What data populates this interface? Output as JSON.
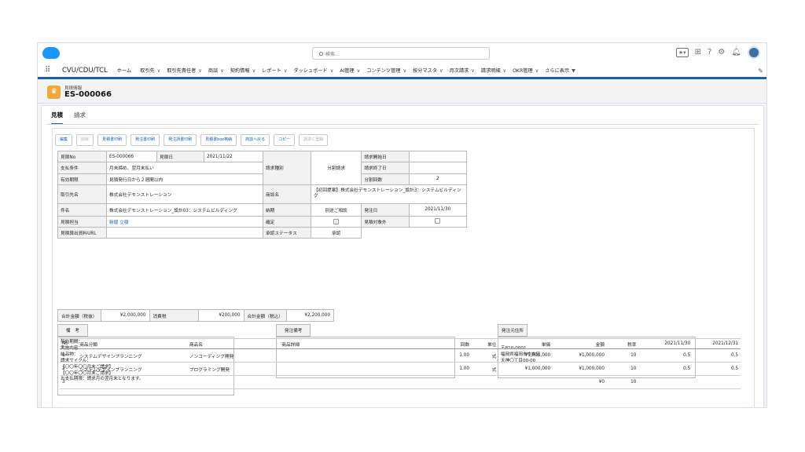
{
  "header": {
    "search_placeholder": "検索...",
    "icons": [
      "star-icon",
      "add-icon",
      "help-icon",
      "gear-icon",
      "bell-icon",
      "avatar"
    ]
  },
  "nav": {
    "app_name": "CVU/CDU/TCL",
    "items": [
      {
        "label": "ホーム",
        "chev": ""
      },
      {
        "label": "取引先",
        "chev": "∨"
      },
      {
        "label": "取引先責任者",
        "chev": "∨"
      },
      {
        "label": "商談",
        "chev": "∨"
      },
      {
        "label": "契約情報",
        "chev": "∨"
      },
      {
        "label": "レポート",
        "chev": "∨"
      },
      {
        "label": "ダッシュボード",
        "chev": "∨"
      },
      {
        "label": "AI管理",
        "chev": "∨"
      },
      {
        "label": "コンテンツ管理",
        "chev": "∨"
      },
      {
        "label": "按分マスタ",
        "chev": "∨"
      },
      {
        "label": "月次請求",
        "chev": "∨"
      },
      {
        "label": "請求明細",
        "chev": "∨"
      },
      {
        "label": "OKR管理",
        "chev": "∨"
      },
      {
        "label": "さらに表示",
        "chev": "▼"
      }
    ]
  },
  "record": {
    "object_label": "見積情報",
    "title": "ES-000066"
  },
  "tabs": [
    "見積",
    "請求"
  ],
  "buttons": [
    {
      "label": "編集",
      "disabled": false
    },
    {
      "label": "削除",
      "disabled": true
    },
    {
      "label": "見積書印刷",
      "disabled": false
    },
    {
      "label": "発注書印刷",
      "disabled": false
    },
    {
      "label": "発注請書印刷",
      "disabled": false
    },
    {
      "label": "見積書box格納",
      "disabled": false
    },
    {
      "label": "商談へ戻る",
      "disabled": false
    },
    {
      "label": "コピー",
      "disabled": false
    },
    {
      "label": "請求に登録",
      "disabled": true
    }
  ],
  "fields": {
    "estimate_no_label": "見積No",
    "estimate_no": "ES-000066",
    "estimate_date_label": "見積日",
    "estimate_date": "2021/11/22",
    "payment_terms_label": "支払条件",
    "payment_terms": "月末締め、翌月末払い",
    "validity_label": "有効期限",
    "validity": "見積発行日から２週間以内",
    "billing_type_label": "請求種別",
    "billing_type": "分割請求",
    "billing_start_label": "請求開始日",
    "billing_start": "",
    "billing_end_label": "請求終了日",
    "billing_end": "",
    "installments_label": "分割回数",
    "installments": "2",
    "account_label": "取引先名",
    "account": "株式会社デモンストレーション",
    "opportunity_label": "商談名",
    "opportunity": "【初回提案】株式会社デモンストレーション_設計3：システムビルディング",
    "subject_label": "件名",
    "subject": "株式会社デモンストレーション_設計03：システムビルディング",
    "delivery_label": "納期",
    "delivery": "別途ご相談",
    "order_date_label": "発注日",
    "order_date": "2021/11/30",
    "owner_label": "見積担当",
    "owner": "新堀 立樹",
    "confirmed_label": "確定",
    "excluded_label": "見積対象外",
    "url_label": "見積算出資料URL",
    "url": "",
    "approval_label": "承認ステータス",
    "approval": "承認"
  },
  "totals": {
    "subtotal_label": "合計金額（税抜）",
    "subtotal": "¥2,000,000",
    "tax_label": "消費税",
    "tax": "¥200,000",
    "total_label": "合計金額（税込）",
    "total": "¥2,200,000"
  },
  "notes": {
    "remarks_label": "備　考",
    "remarks": "契約期間：\n実施内容：\n納品物：\n請求サイクル：\n【〇〇年〇〇月末ご請求】\n【〇〇年〇〇月末ご請求】\nお支払期限：請求月の翌月末となります。",
    "order_remarks_label": "発注備考",
    "order_remarks": "",
    "address_label": "発注元住所",
    "address": "〒810-0001\n福岡県福岡市中央区\n天神〇丁目00-00"
  },
  "line_table": {
    "headers": [
      "No",
      "商品分類",
      "商品名",
      "商品詳細",
      "回数",
      "単位",
      "単価",
      "金額",
      "税率",
      "2021/11/30",
      "2021/12/31"
    ],
    "rows": [
      [
        "1",
        "システムデザインプランニング",
        "ノンコーディング開発",
        "",
        "1.00",
        "式",
        "¥1,000,000",
        "¥1,000,000",
        "10",
        "0.5",
        "0.5"
      ],
      [
        "2",
        "システムデザインプランニング",
        "プログラミング開発",
        "",
        "1.00",
        "式",
        "¥1,000,000",
        "¥1,000,000",
        "10",
        "0.5",
        "0.5"
      ],
      [
        "3",
        "",
        "",
        "",
        "",
        "",
        "",
        "¥0",
        "10",
        "",
        ""
      ]
    ]
  }
}
